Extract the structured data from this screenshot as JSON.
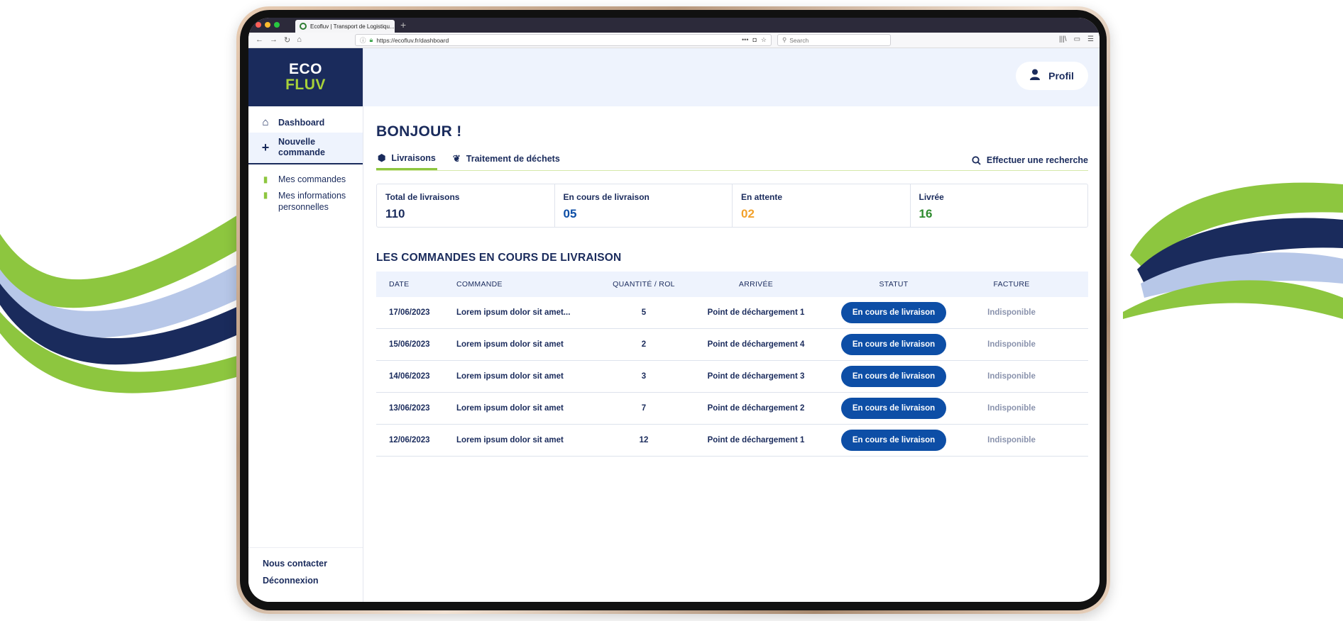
{
  "browser": {
    "tab_title": "Ecofluv | Transport de Logistiqu...",
    "url": "https://ecofluv.fr/dashboard",
    "search_placeholder": "Search"
  },
  "logo": {
    "line1": "ECO",
    "line2": "FLUV"
  },
  "sidebar": {
    "items": [
      {
        "label": "Dashboard",
        "icon": "home-icon"
      },
      {
        "label": "Nouvelle commande",
        "icon": "plus-icon"
      }
    ],
    "sub_items": [
      {
        "label": "Mes commandes",
        "icon": "clipboard-icon"
      },
      {
        "label": "Mes informations personnelles",
        "icon": "id-card-icon"
      }
    ],
    "footer": {
      "contact": "Nous contacter",
      "logout": "Déconnexion"
    }
  },
  "header": {
    "profile_label": "Profil"
  },
  "main": {
    "greeting": "BONJOUR !",
    "tabs": [
      {
        "label": "Livraisons",
        "icon": "box-icon",
        "active": true
      },
      {
        "label": "Traitement de déchets",
        "icon": "sprout-icon",
        "active": false
      }
    ],
    "search_label": "Effectuer une recherche",
    "stats": [
      {
        "label": "Total de livraisons",
        "value": "110",
        "color": "#1a2b5c"
      },
      {
        "label": "En cours de livraison",
        "value": "05",
        "color": "#0d4ea6"
      },
      {
        "label": "En attente",
        "value": "02",
        "color": "#f2a12b"
      },
      {
        "label": "Livrée",
        "value": "16",
        "color": "#2e8b2e"
      }
    ],
    "section_title": "LES COMMANDES EN COURS DE LIVRAISON",
    "table": {
      "headers": [
        "DATE",
        "COMMANDE",
        "QUANTITÉ / ROL",
        "ARRIVÉE",
        "STATUT",
        "FACTURE"
      ],
      "rows": [
        {
          "date": "17/06/2023",
          "commande": "Lorem ipsum dolor sit amet...",
          "quantite": "5",
          "arrivee": "Point de déchargement 1",
          "statut": "En cours de livraison",
          "facture": "Indisponible"
        },
        {
          "date": "15/06/2023",
          "commande": "Lorem ipsum dolor sit amet",
          "quantite": "2",
          "arrivee": "Point de déchargement 4",
          "statut": "En cours de livraison",
          "facture": "Indisponible"
        },
        {
          "date": "14/06/2023",
          "commande": "Lorem ipsum dolor sit amet",
          "quantite": "3",
          "arrivee": "Point de déchargement 3",
          "statut": "En cours de livraison",
          "facture": "Indisponible"
        },
        {
          "date": "13/06/2023",
          "commande": "Lorem ipsum dolor sit amet",
          "quantite": "7",
          "arrivee": "Point de déchargement 2",
          "statut": "En cours de livraison",
          "facture": "Indisponible"
        },
        {
          "date": "12/06/2023",
          "commande": "Lorem ipsum dolor sit amet",
          "quantite": "12",
          "arrivee": "Point de déchargement 1",
          "statut": "En cours de livraison",
          "facture": "Indisponible"
        }
      ]
    }
  },
  "colors": {
    "navy": "#1a2b5c",
    "green": "#8dc63f",
    "blue": "#0d4ea6",
    "light": "#eef3fd"
  }
}
